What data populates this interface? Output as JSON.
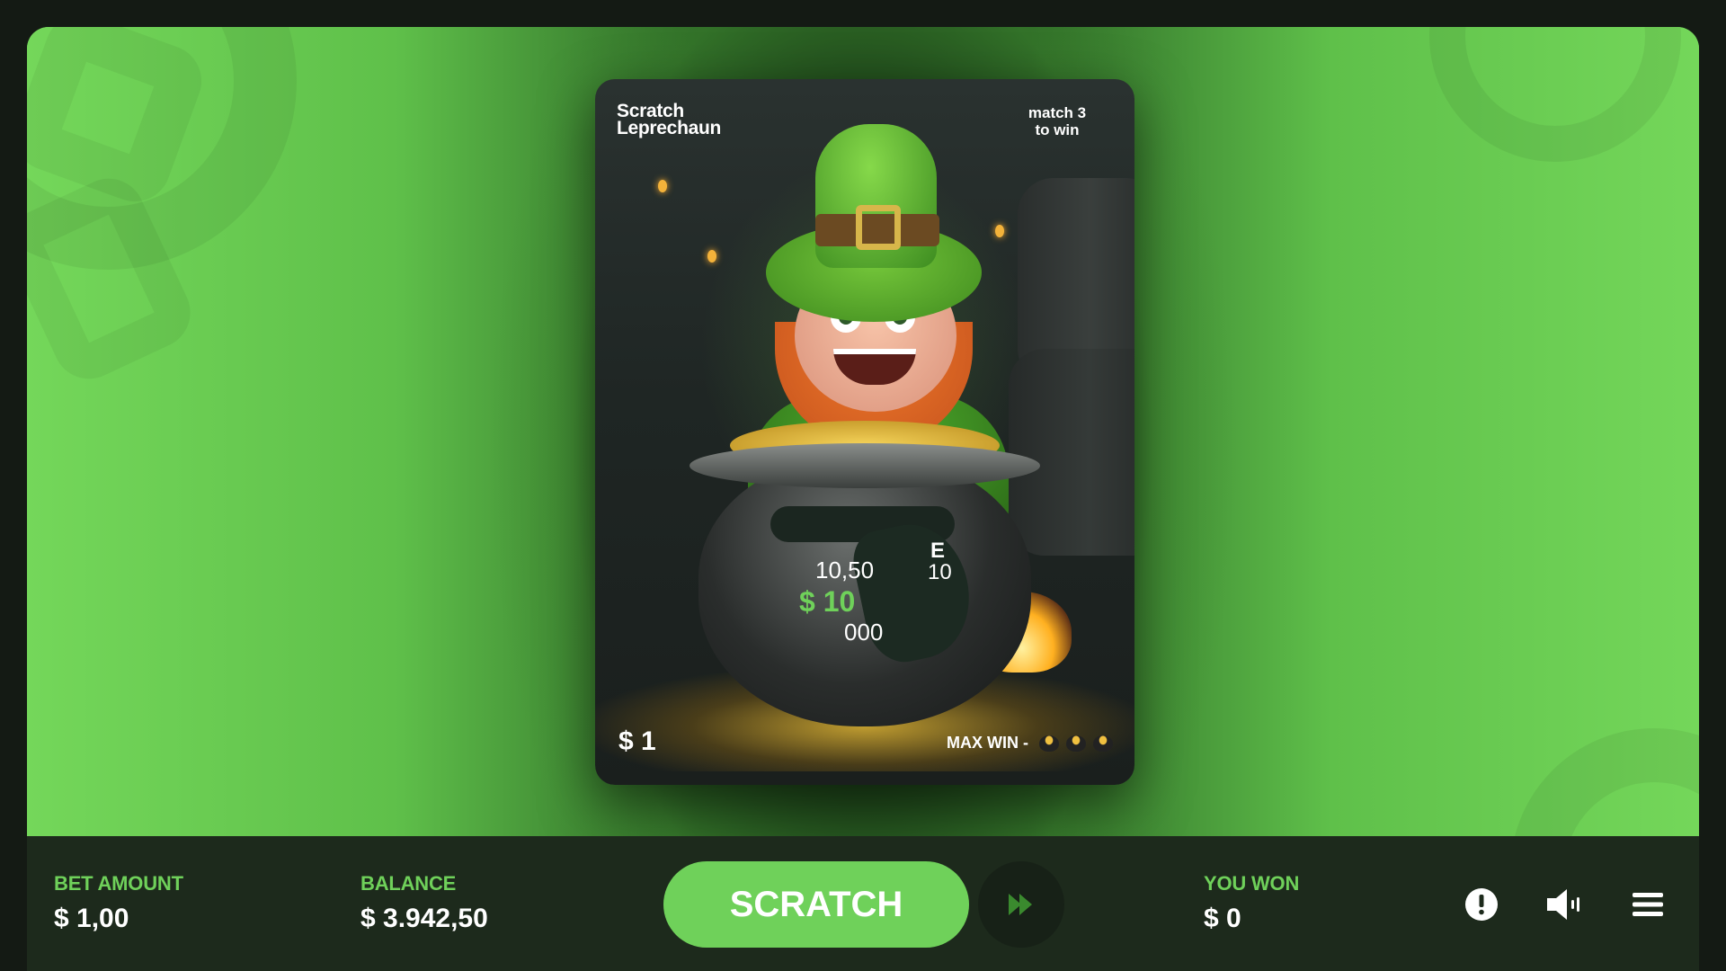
{
  "card": {
    "title_line1": "Scratch",
    "title_line2": "Leprechaun",
    "tagline_line1": "match 3",
    "tagline_line2": "to win",
    "price": "$ 1",
    "max_win_label": "MAX WIN -"
  },
  "revealed": {
    "partial_1": "10,50",
    "partial_2": "$ 10",
    "partial_3": "000",
    "partial_4": "E",
    "partial_5": "10"
  },
  "bet": {
    "label": "BET AMOUNT",
    "value": "$ 1,00"
  },
  "balance": {
    "label": "BALANCE",
    "value": "$ 3.942,50"
  },
  "scratch_button": {
    "label": "SCRATCH"
  },
  "won": {
    "label": "YOU WON",
    "value": "$ 0"
  },
  "icons": {
    "turbo": "fast-forward-icon",
    "info": "exclamation-circle-icon",
    "sound": "speaker-icon",
    "menu": "hamburger-menu-icon"
  },
  "colors": {
    "accent": "#6fd15a",
    "bar_background": "#1d2a1c",
    "frame": "#141a14"
  }
}
